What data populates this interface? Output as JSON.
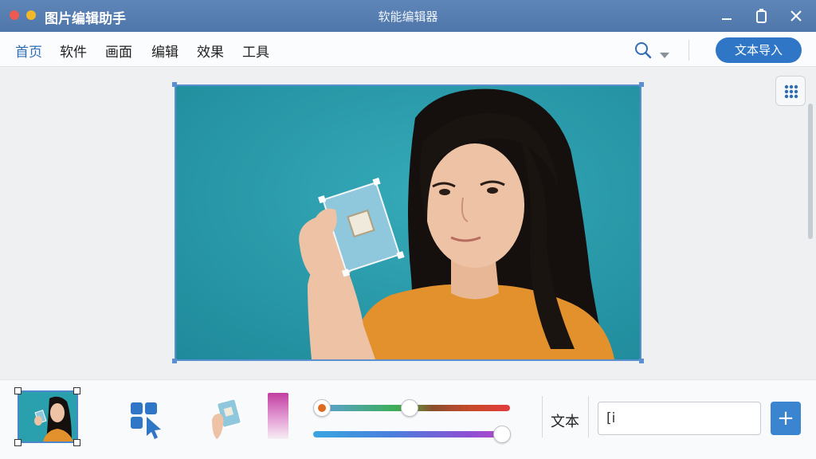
{
  "app": {
    "title": "图片编辑助手",
    "window_title": "软能编辑器"
  },
  "menu": {
    "items": [
      {
        "label": "首页",
        "active": true
      },
      {
        "label": "软件",
        "active": false
      },
      {
        "label": "画面",
        "active": false
      },
      {
        "label": "编辑",
        "active": false
      },
      {
        "label": "效果",
        "active": false
      },
      {
        "label": "工具",
        "active": false
      }
    ],
    "action_button": "文本导入"
  },
  "icons": {
    "search": "search-icon",
    "dropdown": "chevron-down-icon",
    "grid": "grid-icon",
    "select": "select-tool-icon",
    "add": "plus-icon"
  },
  "toolbar": {
    "text_label": "文本",
    "text_input_value": "[i",
    "add_label": "+",
    "slider1_value": 0.45,
    "slider2_value": 1.0
  },
  "colors": {
    "titlebar": "#5580b4",
    "accent": "#2f77c6",
    "photo_background": "#2a9fae",
    "shirt": "#e2912c"
  }
}
